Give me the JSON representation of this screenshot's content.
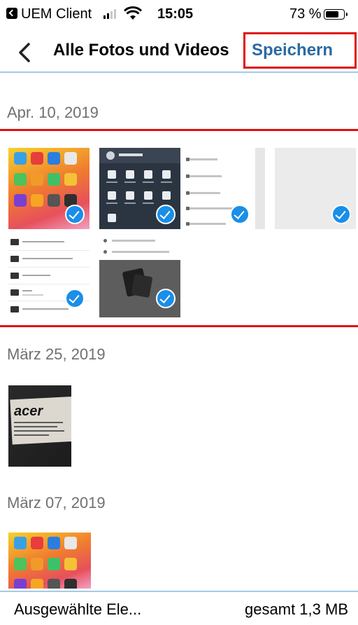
{
  "status_bar": {
    "carrier": "UEM Client",
    "time": "15:05",
    "battery": "73 %",
    "battery_level": 0.73
  },
  "nav": {
    "title": "Alle Fotos und Videos",
    "save_label": "Speichern"
  },
  "sections": [
    {
      "date": "Apr. 10, 2019"
    },
    {
      "date": "März 25, 2019"
    },
    {
      "date": "März 07, 2019"
    }
  ],
  "bottom_bar": {
    "selected_label": "Ausgewählte Ele...",
    "total_label": "gesamt 1,3 MB"
  },
  "colors": {
    "accent": "#2b6aa1",
    "highlight": "#e01010",
    "check": "#1a8ee8",
    "separator": "#a2cbe6"
  }
}
